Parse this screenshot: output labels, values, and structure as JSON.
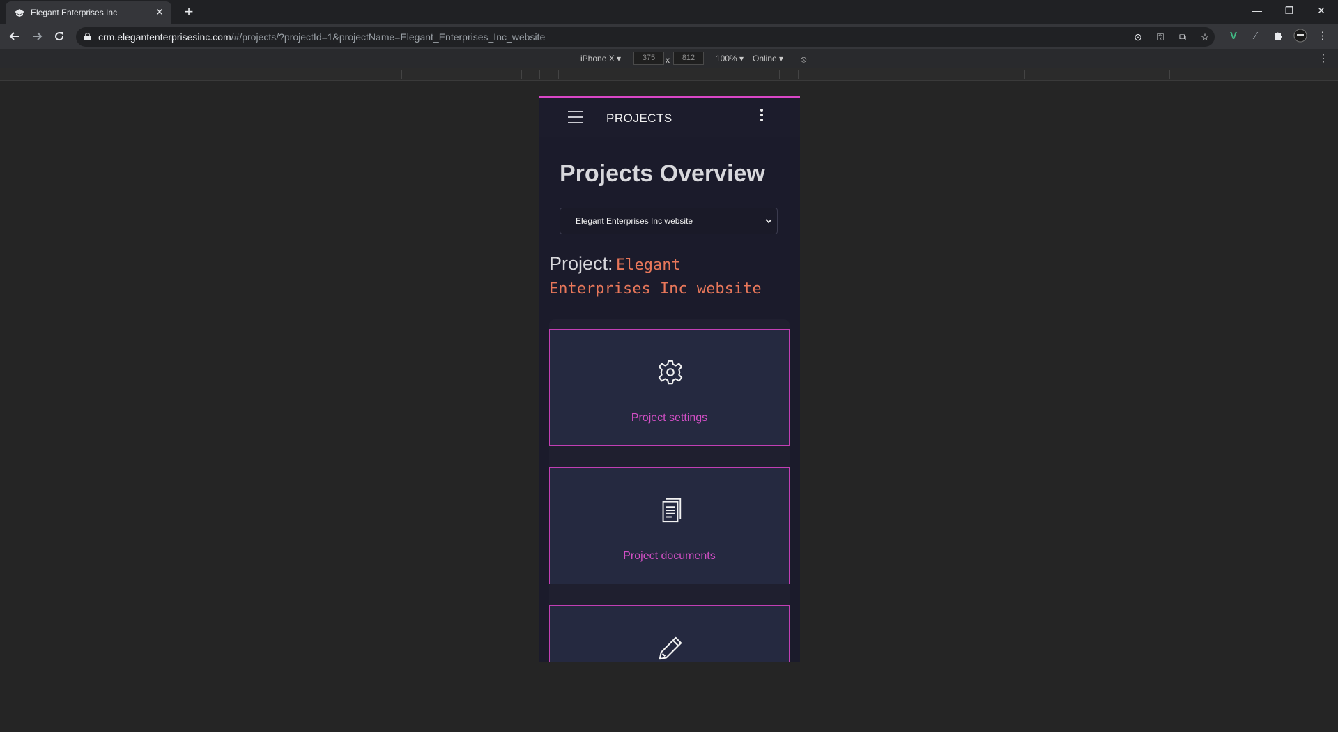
{
  "browser": {
    "tab_title": "Elegant Enterprises Inc",
    "url_host": "crm.elegantenterprisesinc.com",
    "url_path": "/#/projects/?projectId=1&projectName=Elegant_Enterprises_Inc_website"
  },
  "device_toolbar": {
    "device": "iPhone X ▾",
    "width": "375",
    "times": "x",
    "height": "812",
    "zoom": "100% ▾",
    "network": "Online ▾"
  },
  "app": {
    "appbar_title": "PROJECTS",
    "page_title": "Projects Overview",
    "project_select_value": "Elegant Enterprises Inc website",
    "project_prefix": "Project:",
    "project_name": "Elegant Enterprises Inc website",
    "cards": [
      {
        "label": "Project settings",
        "icon": "gear-icon"
      },
      {
        "label": "Project documents",
        "icon": "documents-icon"
      },
      {
        "label": "",
        "icon": "pencil-icon"
      }
    ],
    "accent_color": "#d24fc5",
    "project_name_color": "#e8775a"
  }
}
